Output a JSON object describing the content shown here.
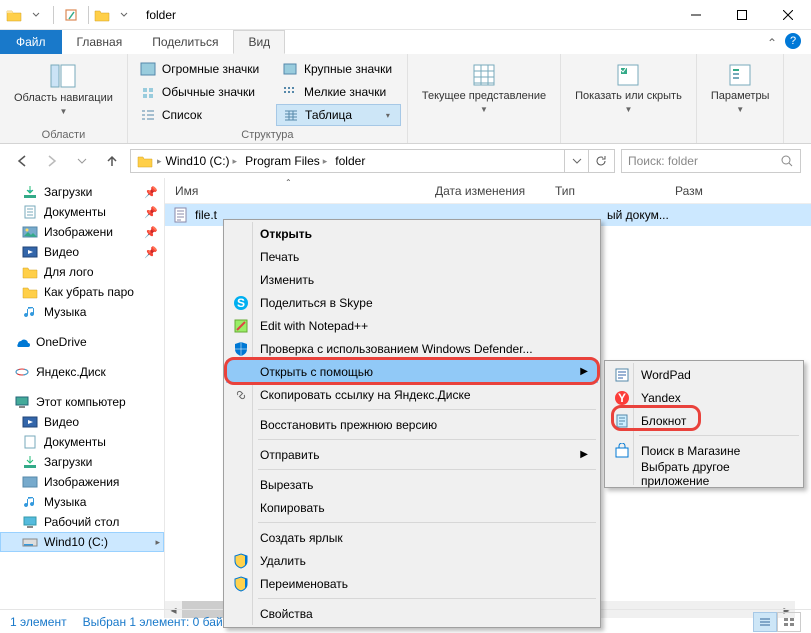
{
  "window": {
    "title": "folder"
  },
  "tabs": {
    "file": "Файл",
    "home": "Главная",
    "share": "Поделиться",
    "view": "Вид"
  },
  "ribbon": {
    "nav_pane": "Область навигации",
    "group_areas": "Области",
    "huge": "Огромные значки",
    "large": "Крупные значки",
    "medium": "Обычные значки",
    "small": "Мелкие значки",
    "list": "Список",
    "table": "Таблица",
    "group_layout": "Структура",
    "current": "Текущее представление",
    "showhide": "Показать или скрыть",
    "options": "Параметры"
  },
  "breadcrumbs": [
    "Wind10 (C:)",
    "Program Files",
    "folder"
  ],
  "search_placeholder": "Поиск: folder",
  "columns": {
    "name": "Имя",
    "date": "Дата изменения",
    "type": "Тип",
    "size": "Разм"
  },
  "file": {
    "name": "file.t",
    "type_trunc": "ый докум..."
  },
  "sidebar": {
    "downloads": "Загрузки",
    "documents": "Документы",
    "images": "Изображени",
    "video": "Видео",
    "for_logo": "Для лого",
    "how_remove": "Как убрать паро",
    "music": "Музыка",
    "onedrive": "OneDrive",
    "yandex": "Яндекс.Диск",
    "this_pc": "Этот компьютер",
    "video2": "Видео",
    "documents2": "Документы",
    "downloads2": "Загрузки",
    "images2": "Изображения",
    "music2": "Музыка",
    "desktop": "Рабочий стол",
    "drive_c": "Wind10 (C:)"
  },
  "ctx": {
    "open": "Открыть",
    "print": "Печать",
    "edit": "Изменить",
    "skype": "Поделиться в Skype",
    "npp": "Edit with Notepad++",
    "defender": "Проверка с использованием Windows Defender...",
    "openwith": "Открыть с помощью",
    "yandex_link": "Скопировать ссылку на Яндекс.Диске",
    "restore": "Восстановить прежнюю версию",
    "sendto": "Отправить",
    "cut": "Вырезать",
    "copy": "Копировать",
    "shortcut": "Создать ярлык",
    "delete": "Удалить",
    "rename": "Переименовать",
    "props": "Свойства"
  },
  "sub": {
    "wordpad": "WordPad",
    "yandex": "Yandex",
    "notepad": "Блокнот",
    "store": "Поиск в Магазине",
    "choose": "Выбрать другое приложение"
  },
  "status": {
    "count": "1 элемент",
    "sel": "Выбран 1 элемент: 0 бай"
  }
}
